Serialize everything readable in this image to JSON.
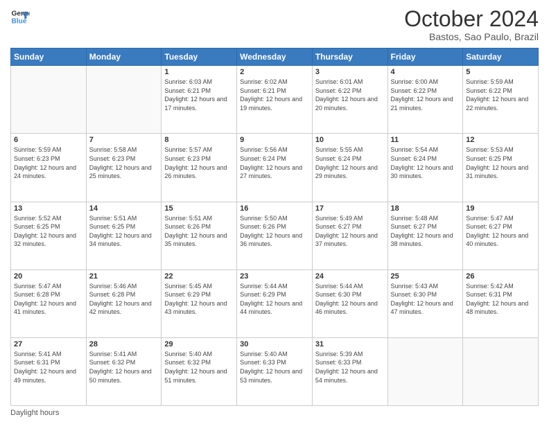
{
  "header": {
    "logo_line1": "General",
    "logo_line2": "Blue",
    "month_title": "October 2024",
    "location": "Bastos, Sao Paulo, Brazil"
  },
  "days_of_week": [
    "Sunday",
    "Monday",
    "Tuesday",
    "Wednesday",
    "Thursday",
    "Friday",
    "Saturday"
  ],
  "weeks": [
    [
      {
        "num": "",
        "info": ""
      },
      {
        "num": "",
        "info": ""
      },
      {
        "num": "1",
        "info": "Sunrise: 6:03 AM\nSunset: 6:21 PM\nDaylight: 12 hours and 17 minutes."
      },
      {
        "num": "2",
        "info": "Sunrise: 6:02 AM\nSunset: 6:21 PM\nDaylight: 12 hours and 19 minutes."
      },
      {
        "num": "3",
        "info": "Sunrise: 6:01 AM\nSunset: 6:22 PM\nDaylight: 12 hours and 20 minutes."
      },
      {
        "num": "4",
        "info": "Sunrise: 6:00 AM\nSunset: 6:22 PM\nDaylight: 12 hours and 21 minutes."
      },
      {
        "num": "5",
        "info": "Sunrise: 5:59 AM\nSunset: 6:22 PM\nDaylight: 12 hours and 22 minutes."
      }
    ],
    [
      {
        "num": "6",
        "info": "Sunrise: 5:59 AM\nSunset: 6:23 PM\nDaylight: 12 hours and 24 minutes."
      },
      {
        "num": "7",
        "info": "Sunrise: 5:58 AM\nSunset: 6:23 PM\nDaylight: 12 hours and 25 minutes."
      },
      {
        "num": "8",
        "info": "Sunrise: 5:57 AM\nSunset: 6:23 PM\nDaylight: 12 hours and 26 minutes."
      },
      {
        "num": "9",
        "info": "Sunrise: 5:56 AM\nSunset: 6:24 PM\nDaylight: 12 hours and 27 minutes."
      },
      {
        "num": "10",
        "info": "Sunrise: 5:55 AM\nSunset: 6:24 PM\nDaylight: 12 hours and 29 minutes."
      },
      {
        "num": "11",
        "info": "Sunrise: 5:54 AM\nSunset: 6:24 PM\nDaylight: 12 hours and 30 minutes."
      },
      {
        "num": "12",
        "info": "Sunrise: 5:53 AM\nSunset: 6:25 PM\nDaylight: 12 hours and 31 minutes."
      }
    ],
    [
      {
        "num": "13",
        "info": "Sunrise: 5:52 AM\nSunset: 6:25 PM\nDaylight: 12 hours and 32 minutes."
      },
      {
        "num": "14",
        "info": "Sunrise: 5:51 AM\nSunset: 6:25 PM\nDaylight: 12 hours and 34 minutes."
      },
      {
        "num": "15",
        "info": "Sunrise: 5:51 AM\nSunset: 6:26 PM\nDaylight: 12 hours and 35 minutes."
      },
      {
        "num": "16",
        "info": "Sunrise: 5:50 AM\nSunset: 6:26 PM\nDaylight: 12 hours and 36 minutes."
      },
      {
        "num": "17",
        "info": "Sunrise: 5:49 AM\nSunset: 6:27 PM\nDaylight: 12 hours and 37 minutes."
      },
      {
        "num": "18",
        "info": "Sunrise: 5:48 AM\nSunset: 6:27 PM\nDaylight: 12 hours and 38 minutes."
      },
      {
        "num": "19",
        "info": "Sunrise: 5:47 AM\nSunset: 6:27 PM\nDaylight: 12 hours and 40 minutes."
      }
    ],
    [
      {
        "num": "20",
        "info": "Sunrise: 5:47 AM\nSunset: 6:28 PM\nDaylight: 12 hours and 41 minutes."
      },
      {
        "num": "21",
        "info": "Sunrise: 5:46 AM\nSunset: 6:28 PM\nDaylight: 12 hours and 42 minutes."
      },
      {
        "num": "22",
        "info": "Sunrise: 5:45 AM\nSunset: 6:29 PM\nDaylight: 12 hours and 43 minutes."
      },
      {
        "num": "23",
        "info": "Sunrise: 5:44 AM\nSunset: 6:29 PM\nDaylight: 12 hours and 44 minutes."
      },
      {
        "num": "24",
        "info": "Sunrise: 5:44 AM\nSunset: 6:30 PM\nDaylight: 12 hours and 46 minutes."
      },
      {
        "num": "25",
        "info": "Sunrise: 5:43 AM\nSunset: 6:30 PM\nDaylight: 12 hours and 47 minutes."
      },
      {
        "num": "26",
        "info": "Sunrise: 5:42 AM\nSunset: 6:31 PM\nDaylight: 12 hours and 48 minutes."
      }
    ],
    [
      {
        "num": "27",
        "info": "Sunrise: 5:41 AM\nSunset: 6:31 PM\nDaylight: 12 hours and 49 minutes."
      },
      {
        "num": "28",
        "info": "Sunrise: 5:41 AM\nSunset: 6:32 PM\nDaylight: 12 hours and 50 minutes."
      },
      {
        "num": "29",
        "info": "Sunrise: 5:40 AM\nSunset: 6:32 PM\nDaylight: 12 hours and 51 minutes."
      },
      {
        "num": "30",
        "info": "Sunrise: 5:40 AM\nSunset: 6:33 PM\nDaylight: 12 hours and 53 minutes."
      },
      {
        "num": "31",
        "info": "Sunrise: 5:39 AM\nSunset: 6:33 PM\nDaylight: 12 hours and 54 minutes."
      },
      {
        "num": "",
        "info": ""
      },
      {
        "num": "",
        "info": ""
      }
    ]
  ],
  "footer": {
    "daylight_label": "Daylight hours"
  }
}
